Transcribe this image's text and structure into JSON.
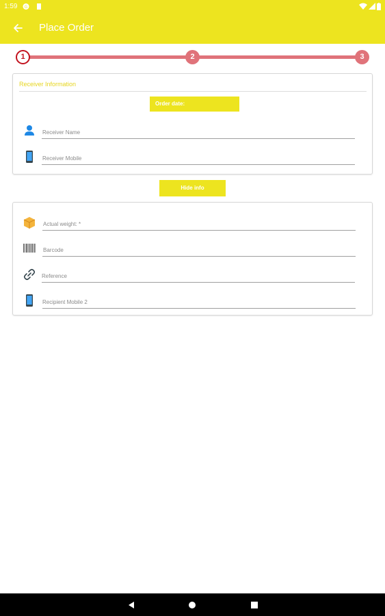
{
  "status_bar": {
    "time": "1:59",
    "icons": [
      "shield-icon",
      "sd-card-icon",
      "wifi-icon",
      "signal-icon",
      "battery-icon"
    ]
  },
  "app_bar": {
    "back_icon": "arrow-back-icon",
    "title": "Place Order"
  },
  "stepper": {
    "steps": [
      {
        "label": "1",
        "state": "active"
      },
      {
        "label": "2",
        "state": "inactive"
      },
      {
        "label": "3",
        "state": "inactive"
      }
    ],
    "colors": {
      "active": "#c2121e",
      "inactive": "#e0737a"
    }
  },
  "receiver_card": {
    "title": "Receiver Information",
    "order_date_label": "Order date:",
    "fields": [
      {
        "icon": "person-icon",
        "placeholder": "Receiver Name",
        "value": ""
      },
      {
        "icon": "mobile-phone-icon",
        "placeholder": "Receiver Mobile",
        "value": ""
      }
    ]
  },
  "hide_info_button": "Hide info",
  "details_card": {
    "fields": [
      {
        "icon": "package-icon",
        "placeholder": "Actual weight: *",
        "value": ""
      },
      {
        "icon": "barcode-icon",
        "placeholder": "Barcode",
        "value": ""
      },
      {
        "icon": "link-icon",
        "placeholder": "Reference",
        "value": ""
      },
      {
        "icon": "mobile-phone-icon",
        "placeholder": "Recipient Mobile 2",
        "value": ""
      }
    ]
  },
  "nav_bar": {
    "buttons": [
      "back-triangle-icon",
      "home-circle-icon",
      "recents-square-icon"
    ]
  },
  "colors": {
    "accent": "#ede41f",
    "title_text": "#e6d51e"
  }
}
